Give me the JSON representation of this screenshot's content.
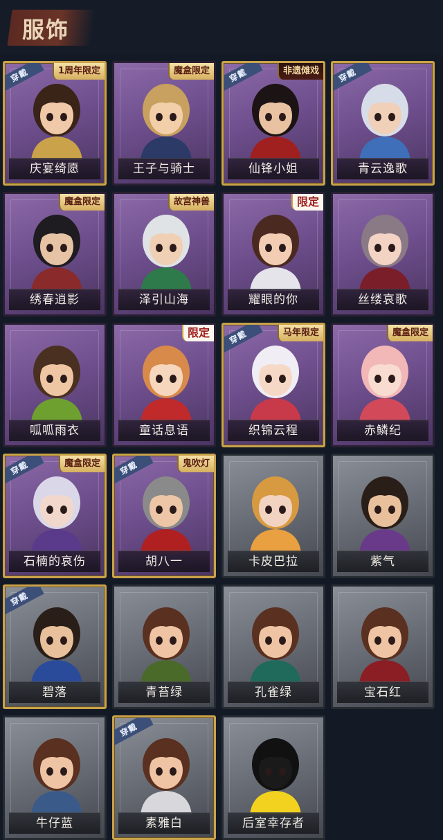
{
  "header": {
    "title": "服饰"
  },
  "wear_tag_label": "穿戴",
  "outfits": [
    {
      "name": "庆宴绮愿",
      "badge": "1周年限定",
      "badge_style": "gold",
      "worn": true,
      "frame": "purple",
      "hair": "#3a2418",
      "skin": "#f0c9a8",
      "accent": "#c9a24a"
    },
    {
      "name": "王子与骑士",
      "badge": "魔盒限定",
      "badge_style": "gold",
      "worn": false,
      "frame": "purple",
      "hair": "#c8a060",
      "skin": "#f2cfa9",
      "accent": "#2b3a66"
    },
    {
      "name": "仙锋小姐",
      "badge": "非遗傩戏",
      "badge_style": "red",
      "worn": true,
      "frame": "purple",
      "hair": "#1c1414",
      "skin": "#e9c2a2",
      "accent": "#a02020"
    },
    {
      "name": "青云逸歌",
      "badge": "",
      "badge_style": "",
      "worn": true,
      "frame": "purple",
      "hair": "#d7dde8",
      "skin": "#f0d0b8",
      "accent": "#3f6fb8"
    },
    {
      "name": "绣春逍影",
      "badge": "魔盒限定",
      "badge_style": "gold",
      "worn": false,
      "frame": "purple",
      "hair": "#1e1c20",
      "skin": "#e6c3a5",
      "accent": "#8a2a2a"
    },
    {
      "name": "泽引山海",
      "badge": "故宫神兽",
      "badge_style": "gold",
      "worn": false,
      "frame": "purple",
      "hair": "#dfe3e6",
      "skin": "#f0d0b4",
      "accent": "#2f7a4a"
    },
    {
      "name": "耀眼的你",
      "badge": "限定",
      "badge_style": "limited",
      "worn": false,
      "frame": "purple",
      "hair": "#4a2a20",
      "skin": "#f2cdb4",
      "accent": "#e4e4ea"
    },
    {
      "name": "丝缕哀歌",
      "badge": "",
      "badge_style": "",
      "worn": false,
      "frame": "purple",
      "hair": "#8a7a86",
      "skin": "#f3d3c4",
      "accent": "#7a1e2a"
    },
    {
      "name": "呱呱雨衣",
      "badge": "",
      "badge_style": "",
      "worn": false,
      "frame": "purple",
      "hair": "#4a3020",
      "skin": "#eec6a4",
      "accent": "#6ea030"
    },
    {
      "name": "童话息语",
      "badge": "限定",
      "badge_style": "limited",
      "worn": false,
      "frame": "purple",
      "hair": "#d88a4a",
      "skin": "#f6d6bc",
      "accent": "#c02a2a"
    },
    {
      "name": "织锦云程",
      "badge": "马年限定",
      "badge_style": "gold",
      "worn": true,
      "frame": "purple",
      "hair": "#f0eef4",
      "skin": "#f6d8c6",
      "accent": "#c83a4a"
    },
    {
      "name": "赤鳞纪",
      "badge": "魔盒限定",
      "badge_style": "gold",
      "worn": false,
      "frame": "purple",
      "hair": "#f2b8b8",
      "skin": "#f8dcd0",
      "accent": "#d24a5a"
    },
    {
      "name": "石楠的哀伤",
      "badge": "魔盒限定",
      "badge_style": "gold",
      "worn": true,
      "frame": "purple",
      "hair": "#dad8e8",
      "skin": "#f2d8cc",
      "accent": "#5a3a8a"
    },
    {
      "name": "胡八一",
      "badge": "鬼吹灯",
      "badge_style": "gold",
      "worn": true,
      "frame": "purple",
      "hair": "#8a8a8a",
      "skin": "#ecc6a6",
      "accent": "#b02020"
    },
    {
      "name": "卡皮巴拉",
      "badge": "",
      "badge_style": "",
      "worn": false,
      "frame": "grey",
      "hair": "#d89a40",
      "skin": "#f2d2c0",
      "accent": "#e8a040"
    },
    {
      "name": "紫气",
      "badge": "",
      "badge_style": "",
      "worn": false,
      "frame": "grey",
      "hair": "#2a1e18",
      "skin": "#e8c09c",
      "accent": "#6a3a8a"
    },
    {
      "name": "碧落",
      "badge": "",
      "badge_style": "",
      "worn": true,
      "frame": "grey",
      "hair": "#2a1e18",
      "skin": "#e8c09c",
      "accent": "#2a4a9a"
    },
    {
      "name": "青苔绿",
      "badge": "",
      "badge_style": "",
      "worn": false,
      "frame": "grey",
      "hair": "#5a3020",
      "skin": "#eec4a4",
      "accent": "#4a6a2a"
    },
    {
      "name": "孔雀绿",
      "badge": "",
      "badge_style": "",
      "worn": false,
      "frame": "grey",
      "hair": "#5a3020",
      "skin": "#eec4a4",
      "accent": "#1f6a5a"
    },
    {
      "name": "宝石红",
      "badge": "",
      "badge_style": "",
      "worn": false,
      "frame": "grey",
      "hair": "#5a3020",
      "skin": "#eec4a4",
      "accent": "#8a1e24"
    },
    {
      "name": "牛仔蓝",
      "badge": "",
      "badge_style": "",
      "worn": false,
      "frame": "grey",
      "hair": "#5a3020",
      "skin": "#eec4a4",
      "accent": "#3a5a8a"
    },
    {
      "name": "素雅白",
      "badge": "",
      "badge_style": "",
      "worn": true,
      "frame": "grey",
      "hair": "#5a3020",
      "skin": "#eec4a4",
      "accent": "#d8d8dc"
    },
    {
      "name": "后室幸存者",
      "badge": "",
      "badge_style": "",
      "worn": false,
      "frame": "grey",
      "hair": "#111111",
      "skin": "#1a1a1a",
      "accent": "#f2d21e"
    }
  ]
}
